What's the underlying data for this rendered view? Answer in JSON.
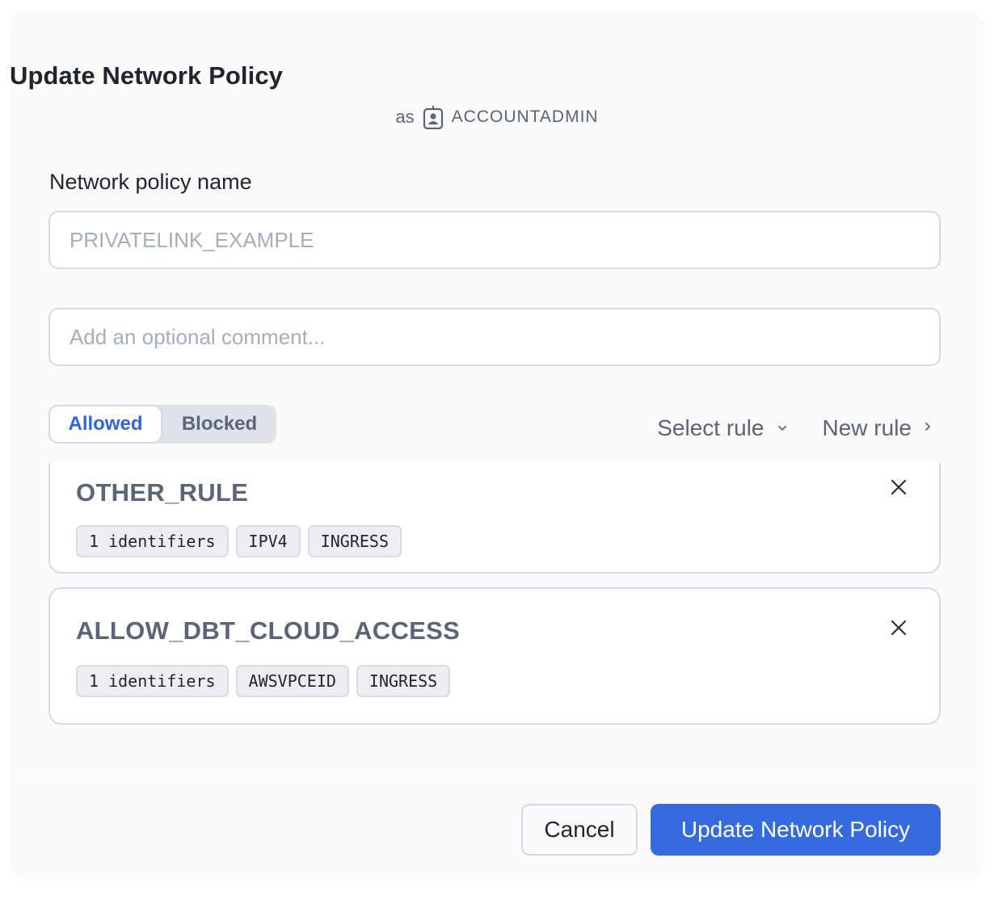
{
  "dialog": {
    "title": "Update Network Policy",
    "subtitle_prefix": "as",
    "role_icon": "user-badge-icon",
    "role": "ACCOUNTADMIN"
  },
  "form": {
    "name_label": "Network policy name",
    "name_value": "",
    "name_placeholder": "PRIVATELINK_EXAMPLE",
    "comment_value": "",
    "comment_placeholder": "Add an optional comment..."
  },
  "tabs": {
    "items": [
      {
        "label": "Allowed",
        "active": true
      },
      {
        "label": "Blocked",
        "active": false
      }
    ]
  },
  "rule_actions": {
    "select_rule": "Select rule",
    "select_rule_icon": "chevron-down-icon",
    "new_rule": "New rule",
    "new_rule_icon": "chevron-right-icon"
  },
  "rules": [
    {
      "name": "OTHER_RULE",
      "tags": [
        "1 identifiers",
        "IPV4",
        "INGRESS"
      ]
    },
    {
      "name": "ALLOW_DBT_CLOUD_ACCESS",
      "tags": [
        "1 identifiers",
        "AWSVPCEID",
        "INGRESS"
      ]
    }
  ],
  "footer": {
    "cancel_label": "Cancel",
    "submit_label": "Update Network Policy"
  },
  "colors": {
    "accent": "#366bdf",
    "active_tab_text": "#2f66dc",
    "muted_text": "#5b6579",
    "border": "#d6dbe6",
    "dialog_bg": "#fafafa"
  }
}
